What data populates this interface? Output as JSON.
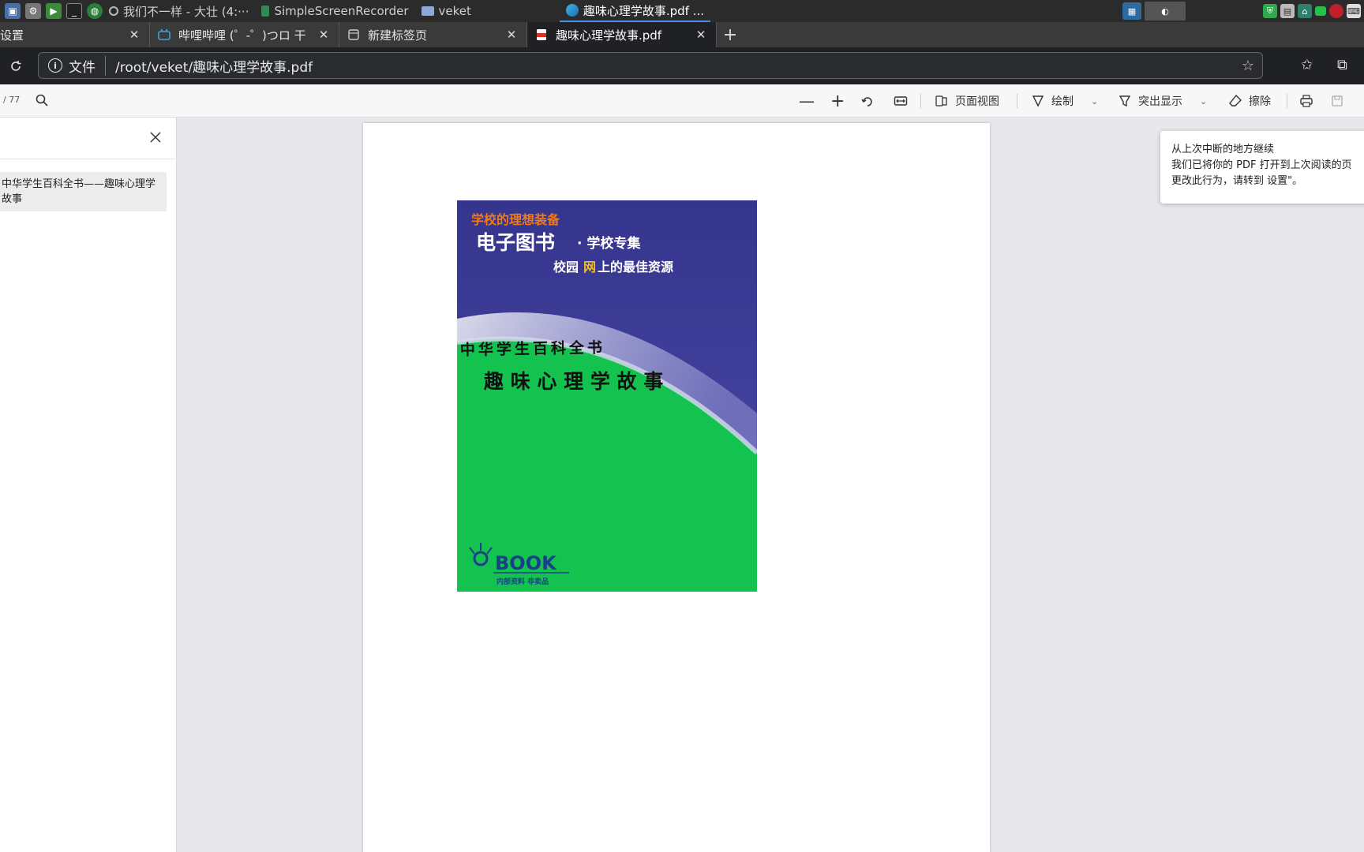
{
  "taskbar": {
    "tasks": [
      {
        "label": "我们不一样 - 大壮 (4:···"
      },
      {
        "label": "SimpleScreenRecorder"
      },
      {
        "label": "veket"
      },
      {
        "label": "趣味心理学故事.pdf ..."
      }
    ]
  },
  "tabs": [
    {
      "label": "设置"
    },
    {
      "label": "哔哩哔哩 (゜-゜)つロ 干"
    },
    {
      "label": "新建标签页"
    },
    {
      "label": "趣味心理学故事.pdf"
    }
  ],
  "address": {
    "scheme": "文件",
    "url": "/root/veket/趣味心理学故事.pdf"
  },
  "pdf_toolbar": {
    "page_count": "/ 77",
    "page_view": "页面视图",
    "draw": "绘制",
    "highlight": "突出显示",
    "erase": "擦除"
  },
  "sidebar": {
    "outline_item": "中华学生百科全书——趣味心理学故事"
  },
  "cover": {
    "series": "学校的理想装备",
    "title_big": "电子图书",
    "title_small": "· 学校专集",
    "tagline_a": "校园",
    "tagline_b": "网",
    "tagline_c": "上的最佳资源",
    "encyclopedia": "中华学生百科全书",
    "book_title": "趣 味 心 理 学 故 事",
    "logo_text": "BOOK",
    "logo_sub": "内部资料 非卖品",
    "colors": {
      "top": "#3b3a96",
      "bottom": "#14c24f",
      "accent": "#f07a1a"
    }
  },
  "toast": {
    "title": "从上次中断的地方继续",
    "line1": "我们已将你的 PDF 打开到上次阅读的页",
    "line2": "更改此行为，请转到 设置\"。"
  }
}
